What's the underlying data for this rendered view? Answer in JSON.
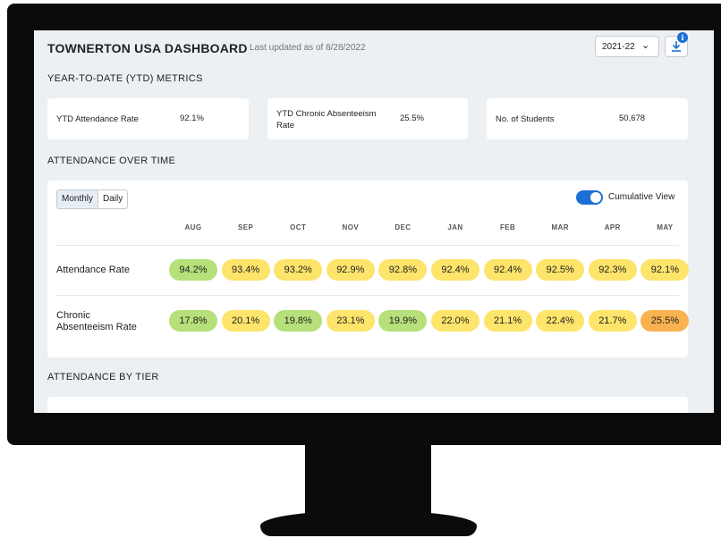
{
  "header": {
    "title": "TOWNERTON USA DASHBOARD",
    "updated": "Last updated as of 8/28/2022",
    "year_select": "2021-22"
  },
  "icons": {
    "select_chevron": "chevron-down-icon",
    "download": "download-icon",
    "info_badge": "info-icon",
    "info_glyph": "i"
  },
  "ytd": {
    "section_title": "YEAR-TO-DATE (YTD) METRICS",
    "attendance": {
      "label": "YTD Attendance Rate",
      "value": "92.1%"
    },
    "chronic": {
      "label_line1": "YTD Chronic Absenteeism",
      "label_line2": "Rate",
      "value": "25.5%"
    },
    "students": {
      "label": "No. of Students",
      "value": "50,678"
    }
  },
  "attendance_over_time": {
    "section_title": "ATTENDANCE OVER TIME",
    "view_toggle": [
      "Monthly",
      "Daily"
    ],
    "active_view": "Monthly",
    "cumulative_label": "Cumulative View",
    "cumulative_on": true,
    "months": [
      "AUG",
      "SEP",
      "OCT",
      "NOV",
      "DEC",
      "JAN",
      "FEB",
      "MAR",
      "APR",
      "MAY"
    ],
    "rows": [
      {
        "label_line1": "Attendance Rate",
        "label_line2": "",
        "values": [
          "94.2%",
          "93.4%",
          "93.2%",
          "92.9%",
          "92.8%",
          "92.4%",
          "92.4%",
          "92.5%",
          "92.3%",
          "92.1%"
        ],
        "levels": [
          "good",
          "mid",
          "mid",
          "mid",
          "mid",
          "mid",
          "mid",
          "mid",
          "mid",
          "mid"
        ]
      },
      {
        "label_line1": "Chronic",
        "label_line2": "Absenteeism Rate",
        "values": [
          "17.8%",
          "20.1%",
          "19.8%",
          "23.1%",
          "19.9%",
          "22.0%",
          "21.1%",
          "22.4%",
          "21.7%",
          "25.5%"
        ],
        "levels": [
          "good",
          "mid",
          "good",
          "mid",
          "good",
          "mid",
          "mid",
          "mid",
          "mid",
          "bad"
        ]
      }
    ]
  },
  "attendance_by_tier": {
    "section_title": "ATTENDANCE BY TIER"
  },
  "colors": {
    "good": "#b5e07a",
    "mid": "#fde46a",
    "bad": "#f9b24f",
    "accent": "#1d6fd6"
  }
}
